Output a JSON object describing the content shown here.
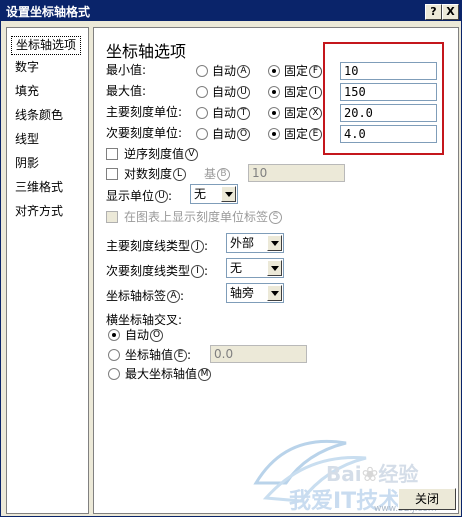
{
  "window": {
    "title": "设置坐标轴格式",
    "help_label": "?",
    "close_label": "X"
  },
  "sidebar": {
    "items": [
      {
        "label": "坐标轴选项",
        "selected": true
      },
      {
        "label": "数字"
      },
      {
        "label": "填充"
      },
      {
        "label": "线条颜色"
      },
      {
        "label": "线型"
      },
      {
        "label": "阴影"
      },
      {
        "label": "三维格式"
      },
      {
        "label": "对齐方式"
      }
    ]
  },
  "panel": {
    "heading": "坐标轴选项",
    "rows": [
      {
        "label": "最小值:",
        "auto_label": "自动",
        "auto_key": "A",
        "fixed_label": "固定",
        "fixed_key": "F",
        "value": "10",
        "selected": "fixed"
      },
      {
        "label": "最大值:",
        "auto_label": "自动",
        "auto_key": "U",
        "fixed_label": "固定",
        "fixed_key": "I",
        "value": "150",
        "selected": "fixed"
      },
      {
        "label": "主要刻度单位:",
        "auto_label": "自动",
        "auto_key": "T",
        "fixed_label": "固定",
        "fixed_key": "X",
        "value": "20.0",
        "selected": "fixed"
      },
      {
        "label": "次要刻度单位:",
        "auto_label": "自动",
        "auto_key": "O",
        "fixed_label": "固定",
        "fixed_key": "E",
        "value": "4.0",
        "selected": "fixed"
      }
    ],
    "reverse_order": {
      "label": "逆序刻度值",
      "key": "V"
    },
    "log_scale": {
      "label": "对数刻度",
      "key": "L",
      "base_label": "基",
      "base_key": "B",
      "base_value": "10"
    },
    "display_units": {
      "label": "显示单位",
      "key": "U",
      "value": "无"
    },
    "show_units_label": {
      "label": "在图表上显示刻度单位标签",
      "key": "S"
    },
    "major_tick_type": {
      "label": "主要刻度线类型",
      "key": "J",
      "value": "外部"
    },
    "minor_tick_type": {
      "label": "次要刻度线类型",
      "key": "I",
      "value": "无"
    },
    "axis_labels": {
      "label": "坐标轴标签",
      "key": "A",
      "value": "轴旁"
    },
    "cross": {
      "heading": "横坐标轴交叉:",
      "auto": {
        "label": "自动",
        "key": "O"
      },
      "axis_value": {
        "label": "坐标轴值",
        "key": "E",
        "value": "0.0"
      },
      "max_value": {
        "label": "最大坐标轴值",
        "key": "M"
      },
      "selected": "auto"
    }
  },
  "footer": {
    "close_button": "关闭"
  },
  "watermark": {
    "brand": "Bai",
    "brand_suffix": "经验",
    "site_cn": "我爱IT技术网",
    "site_url": "www.52ij.com"
  },
  "colors": {
    "titlebar": "#0a246a",
    "dialog_bg": "#ece9d8",
    "highlight": "#c4161c"
  }
}
